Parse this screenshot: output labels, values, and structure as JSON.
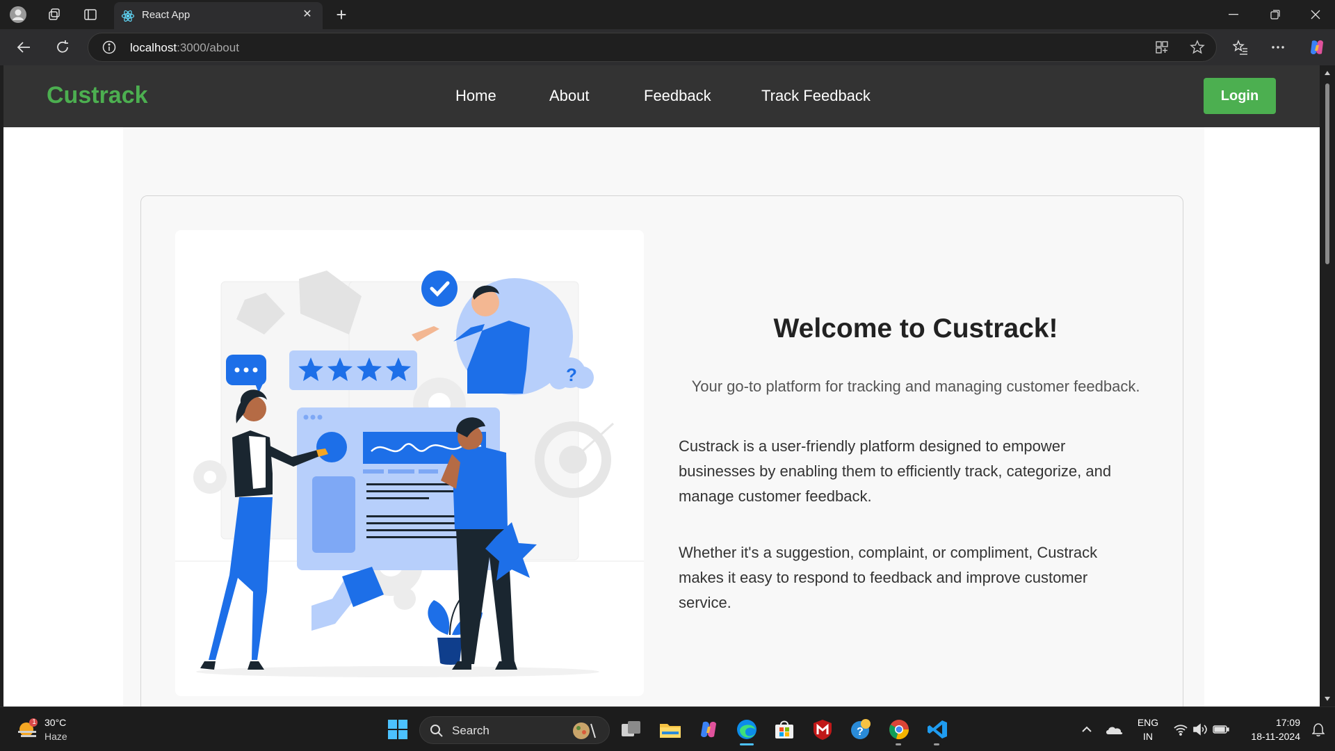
{
  "browser": {
    "tab_title": "React App",
    "url_host": "localhost",
    "url_rest": ":3000/about"
  },
  "app": {
    "brand": "Custrack",
    "nav": [
      "Home",
      "About",
      "Feedback",
      "Track Feedback"
    ],
    "login_label": "Login",
    "brand_color": "#4caf50"
  },
  "about": {
    "heading": "Welcome to Custrack!",
    "tagline": "Your go-to platform for tracking and managing customer feedback.",
    "paragraph_1": "Custrack is a user-friendly platform designed to empower businesses by enabling them to efficiently track, categorize, and manage customer feedback.",
    "paragraph_2": "Whether it's a suggestion, complaint, or compliment, Custrack makes it easy to respond to feedback and improve customer service.",
    "illustration": "customer-feedback-illustration"
  },
  "taskbar": {
    "weather_temp": "30°C",
    "weather_desc": "Haze",
    "weather_badge": "1",
    "search_label": "Search",
    "lang_1": "ENG",
    "lang_2": "IN",
    "time": "17:09",
    "date": "18-11-2024"
  }
}
